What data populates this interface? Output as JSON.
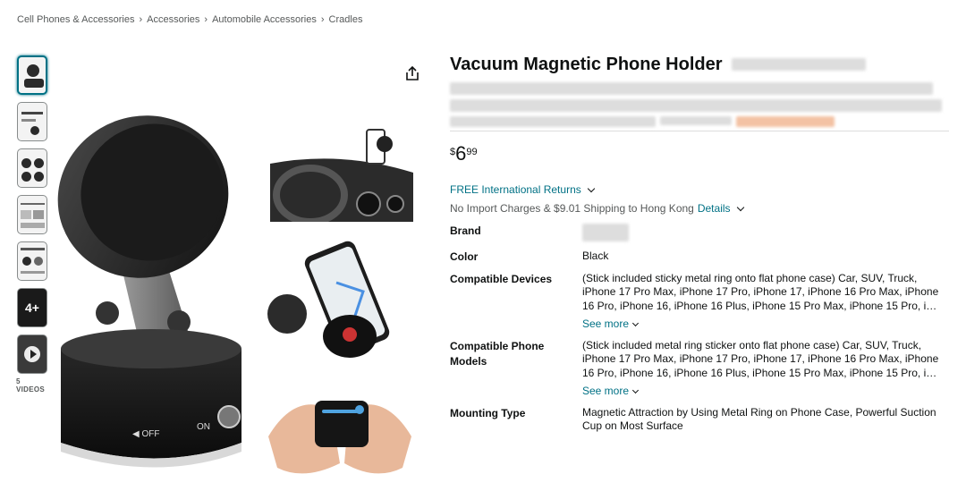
{
  "breadcrumb": {
    "items": [
      "Cell Phones & Accessories",
      "Accessories",
      "Automobile Accessories",
      "Cradles"
    ],
    "separator": "›"
  },
  "gallery": {
    "more_count": "4+",
    "videos_label": "5 VIDEOS",
    "main_labels": {
      "off": "◀ OFF",
      "on": "ON"
    }
  },
  "product": {
    "title": "Vacuum Magnetic Phone Holder",
    "price": {
      "symbol": "$",
      "whole": "6",
      "fraction": "99"
    },
    "returns": "FREE International Returns",
    "shipping": "No Import Charges & $9.01 Shipping to Hong Kong",
    "shipping_details_link": "Details"
  },
  "specs": [
    {
      "key": "Brand",
      "value": ""
    },
    {
      "key": "Color",
      "value": "Black"
    },
    {
      "key": "Compatible Devices",
      "value": "(Stick included sticky metal ring onto flat phone case) Car, SUV, Truck, iPhone 17 Pro Max, iPhone 17 Pro, iPhone 17, iPhone 16 Pro Max, iPhone 16 Pro, iPhone 16, iPhone 16 Plus, iPhone 15 Pro Max, iPhone 15 Pro, i…",
      "see_more": "See more"
    },
    {
      "key": "Compatible Phone Models",
      "value": "(Stick included metal ring sticker onto flat phone case) Car, SUV, Truck, iPhone 17 Pro Max, iPhone 17 Pro, iPhone 17, iPhone 16 Pro Max, iPhone 16 Pro, iPhone 16, iPhone 16 Plus, iPhone 15 Pro Max, iPhone 15 Pro, i…",
      "see_more": "See more"
    },
    {
      "key": "Mounting Type",
      "value": "Magnetic Attraction by Using Metal Ring on Phone Case, Powerful Suction Cup on Most Surface"
    }
  ],
  "colors": {
    "link": "#007185",
    "text": "#0f1111",
    "muted": "#565959"
  }
}
